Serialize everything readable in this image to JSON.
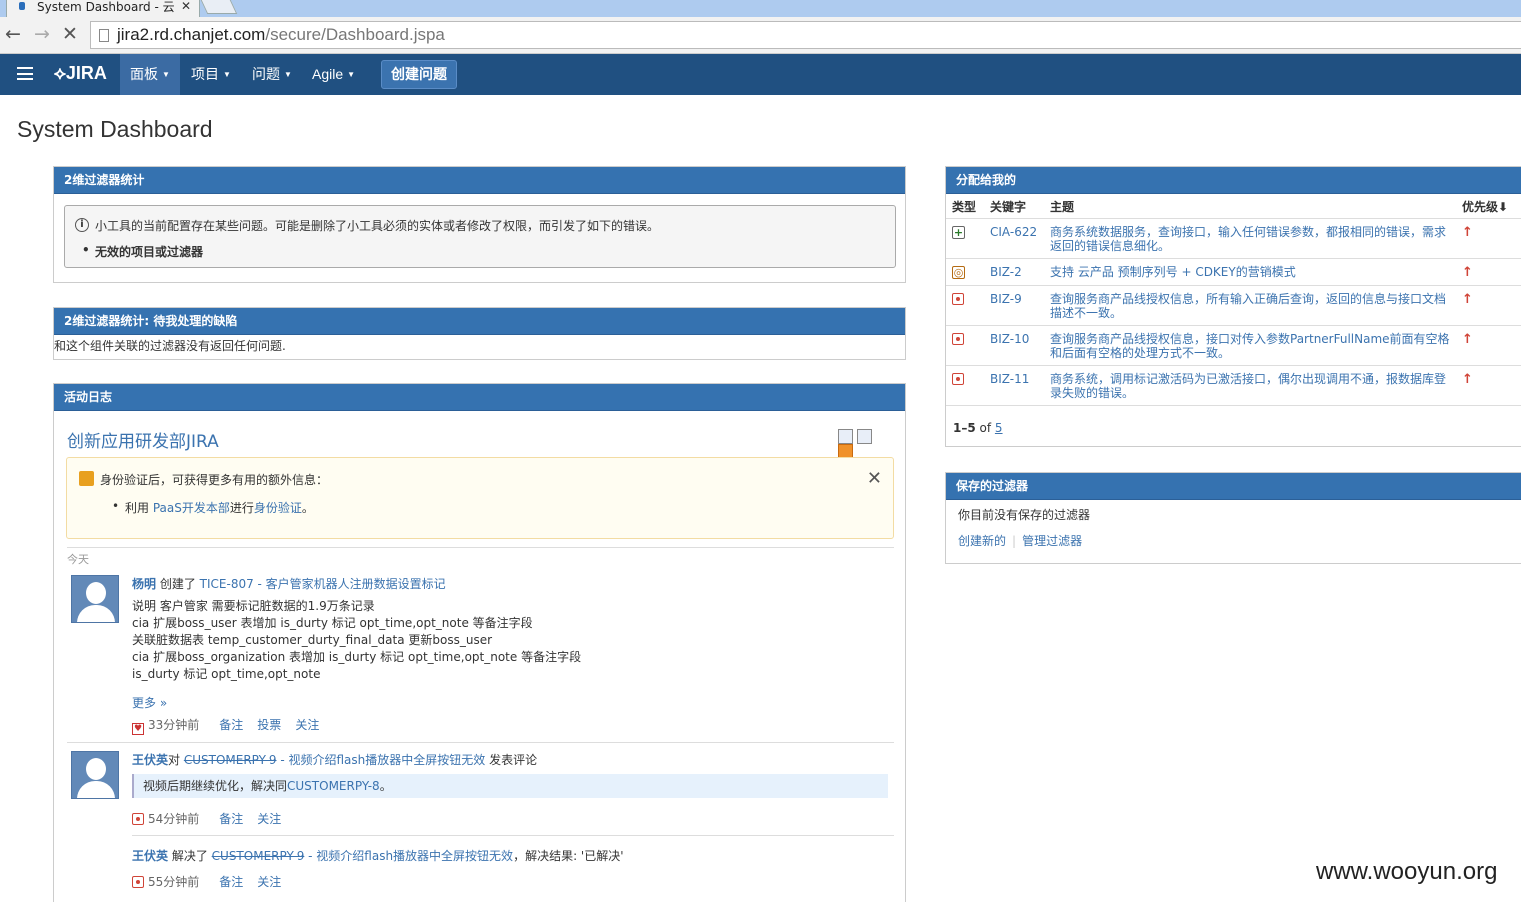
{
  "browser": {
    "tab_title": "System Dashboard - 云",
    "url_host": "jira2.rd.chanjet.com",
    "url_path": "/secure/Dashboard.jspa"
  },
  "header": {
    "logo": "JIRA",
    "menus": [
      "面板",
      "项目",
      "问题",
      "Agile"
    ],
    "create_label": "创建问题"
  },
  "page_title": "System Dashboard",
  "gadget1": {
    "title": "2维过滤器统计",
    "warning": "小工具的当前配置存在某些问题。可能是删除了小工具必须的实体或者修改了权限，而引发了如下的错误。",
    "error_item": "无效的项目或过滤器"
  },
  "gadget2": {
    "title": "2维过滤器统计: 待我处理的缺陷",
    "content": "和这个组件关联的过滤器没有返回任何问题."
  },
  "activity": {
    "title": "活动日志",
    "subtitle": "创新应用研发部JIRA",
    "notice_msg": "身份验证后，可获得更多有用的额外信息：",
    "notice_pre": "利用 ",
    "notice_link": "PaaS开发本部",
    "notice_mid": "进行",
    "notice_link2": "身份验证",
    "notice_end": "。",
    "today": "今天",
    "entry1": {
      "user": "杨明",
      "verb": " 创建了 ",
      "issue": "TICE-807 - 客户管家机器人注册数据设置标记",
      "lines": [
        "说明 客户管家 需要标记脏数据的1.9万条记录",
        "cia 扩展boss_user 表增加 is_durty 标记 opt_time,opt_note 等备注字段",
        "关联脏数据表 temp_customer_durty_final_data 更新boss_user",
        "cia 扩展boss_organization 表增加 is_durty 标记 opt_time,opt_note 等备注字段",
        "is_durty 标记 opt_time,opt_note"
      ],
      "more": "更多 »",
      "time": "33分钟前",
      "actions": [
        "备注",
        "投票",
        "关注"
      ]
    },
    "entry2": {
      "user": "王伏英",
      "verb": "对 ",
      "issue_key": "CUSTOMERPY-9",
      "issue_title": " - 视频介绍flash播放器中全屏按钮无效",
      "tail": " 发表评论",
      "quote_pre": "视频后期继续优化，解决同",
      "quote_link": "CUSTOMERPY-8",
      "quote_end": "。",
      "time": "54分钟前",
      "actions": [
        "备注",
        "关注"
      ]
    },
    "entry3": {
      "user": "王伏英",
      "verb": " 解决了 ",
      "issue_key": "CUSTOMERPY-9",
      "issue_title": " - 视频介绍flash播放器中全屏按钮无效",
      "tail": "，解决结果: '已解决'",
      "time": "55分钟前",
      "actions": [
        "备注",
        "关注"
      ]
    }
  },
  "assigned": {
    "title": "分配给我的",
    "headers": [
      "类型",
      "关键字",
      "主题",
      "优先级"
    ],
    "rows": [
      {
        "key": "CIA-622",
        "summary": "商务系统数据服务，查询接口，输入任何错误参数，都报相同的错误，需求返回的错误信息细化。",
        "type": "improvement"
      },
      {
        "key": "BIZ-2",
        "summary": "支持 云产品 预制序列号 + CDKEY的营销模式",
        "type": "feature"
      },
      {
        "key": "BIZ-9",
        "summary": "查询服务商产品线授权信息，所有输入正确后查询，返回的信息与接口文档描述不一致。",
        "type": "bug"
      },
      {
        "key": "BIZ-10",
        "summary": "查询服务商产品线授权信息，接口对传入参数PartnerFullName前面有空格和后面有空格的处理方式不一致。",
        "type": "bug"
      },
      {
        "key": "BIZ-11",
        "summary": "商务系统，调用标记激活码为已激活接口，偶尔出现调用不通，报数据库登录失败的错误。",
        "type": "bug"
      }
    ],
    "pager_range": "1–5",
    "pager_of": " of ",
    "pager_total": "5"
  },
  "filters": {
    "title": "保存的过滤器",
    "content": "你目前没有保存的过滤器",
    "create_new": "创建新的",
    "manage": "管理过滤器"
  },
  "watermark": "www.wooyun.org",
  "colors": {
    "header": "#205081",
    "gadget_header": "#3572b0",
    "link": "#3b73af",
    "priority": "#d04437"
  }
}
